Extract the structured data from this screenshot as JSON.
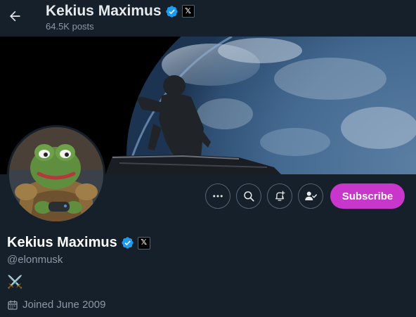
{
  "header": {
    "back_icon": "arrow-left-icon",
    "display_name": "Kekius Maximus",
    "posts_count": "64.5K posts",
    "verified_icon": "verified-badge-icon",
    "affiliate_label": "𝕏"
  },
  "banner": {
    "description_icon": "astronaut-earth-banner"
  },
  "avatar": {
    "icon": "frog-warrior-avatar"
  },
  "actions": {
    "more_icon": "more-dots-icon",
    "search_icon": "search-icon",
    "notify_icon": "bell-plus-icon",
    "following_icon": "user-check-icon",
    "subscribe_label": "Subscribe"
  },
  "profile": {
    "display_name": "Kekius Maximus",
    "handle": "@elonmusk",
    "affiliate_label": "𝕏",
    "bio": "⚔️",
    "joined": "Joined June 2009",
    "calendar_icon": "calendar-icon"
  },
  "colors": {
    "background": "#15202b",
    "verified": "#1d9bf0",
    "subscribe": "#c936cc",
    "muted_text": "#8b98a5"
  }
}
